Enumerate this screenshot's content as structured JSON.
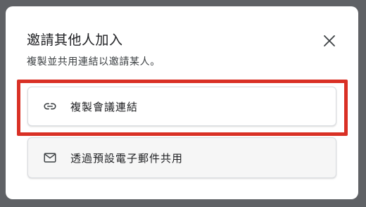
{
  "dialog": {
    "title": "邀請其他人加入",
    "subtitle": "複製並共用連結以邀請某人。",
    "close_icon": "close-icon",
    "options": [
      {
        "label": "複製會議連結",
        "icon": "link-icon"
      },
      {
        "label": "透過預設電子郵件共用",
        "icon": "mail-icon"
      }
    ]
  },
  "colors": {
    "highlight": "#d93025",
    "backdrop": "#5f6165"
  }
}
